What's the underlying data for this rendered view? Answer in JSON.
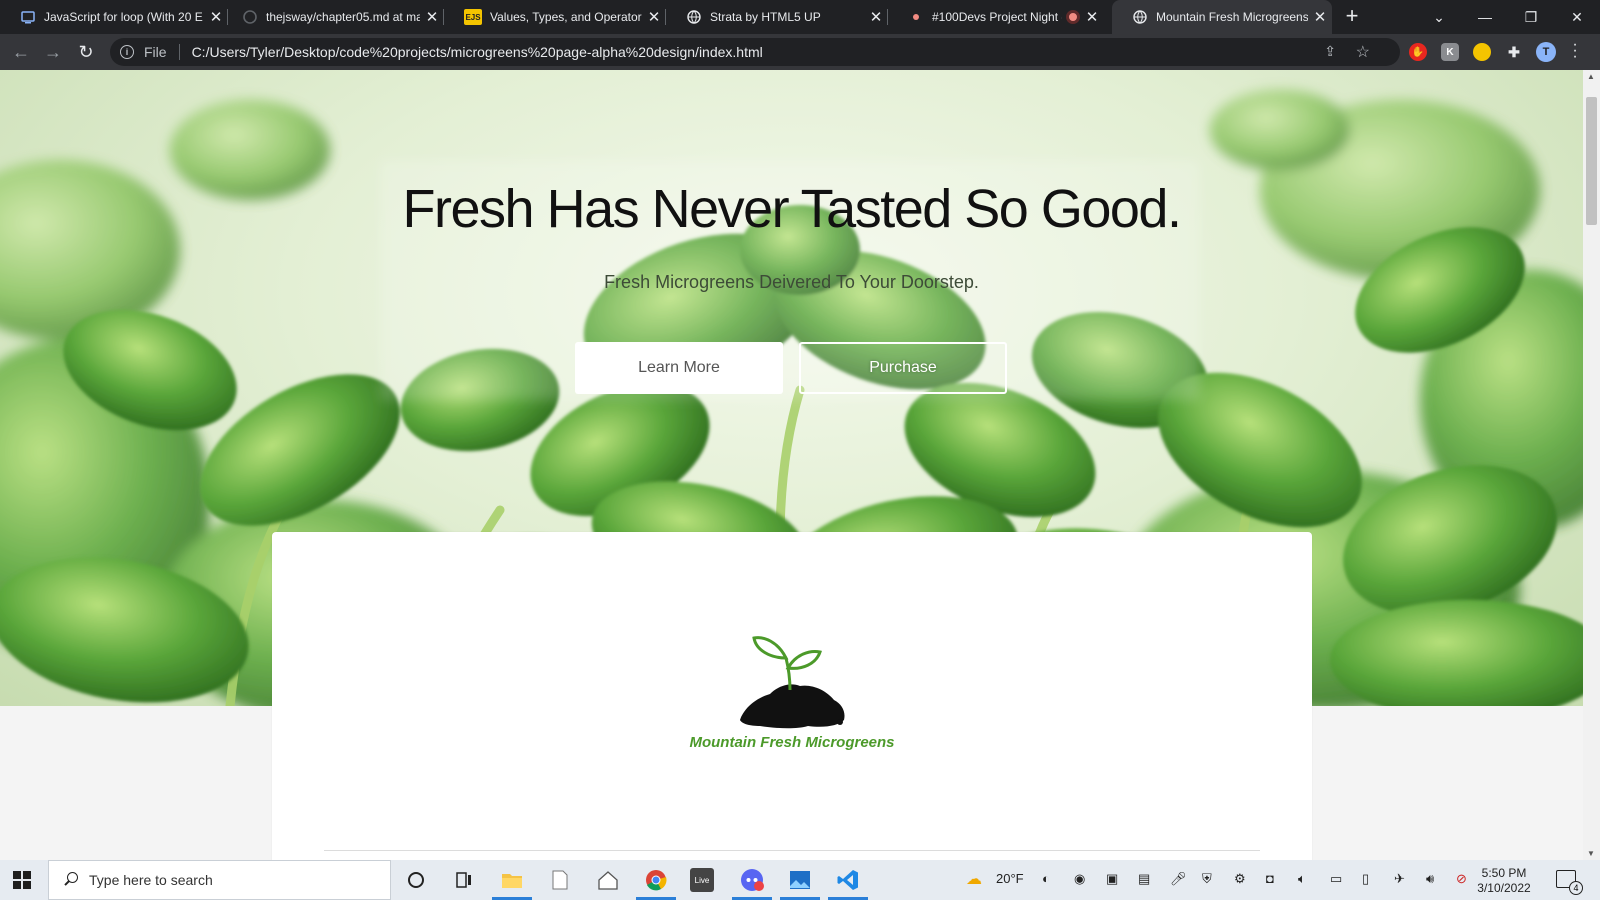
{
  "browser": {
    "tabs": [
      {
        "title": "JavaScript for loop (With 20 E",
        "icon": "programiz-icon",
        "active": false
      },
      {
        "title": "thejsway/chapter05.md at ma",
        "icon": "github-icon",
        "active": false
      },
      {
        "title": "Values, Types, and Operators",
        "icon": "ejs-icon",
        "icon_text": "EJS",
        "active": false
      },
      {
        "title": "Strata by HTML5 UP",
        "icon": "globe-icon",
        "active": false
      },
      {
        "title": "#100Devs Project Night -",
        "icon": "twitch-icon",
        "active": false
      },
      {
        "title": "Mountain Fresh Microgreens",
        "icon": "globe-icon",
        "active": true
      }
    ],
    "new_tab": "+",
    "address": {
      "scheme_label": "File",
      "url": "C:/Users/Tyler/Desktop/code%20projects/microgreens%20page-alpha%20design/index.html"
    },
    "profile_initial": "T"
  },
  "page": {
    "hero": {
      "title": "Fresh Has Never Tasted So Good.",
      "subtitle": "Fresh Microgreens Deivered To Your Doorstep.",
      "buttons": {
        "learn_more": "Learn More",
        "purchase": "Purchase"
      }
    },
    "logo": {
      "brand": "Mountain Fresh Microgreens"
    },
    "colors": {
      "brand_green": "#4c9a2a",
      "hero_leaf_green": "#5aa63a"
    }
  },
  "taskbar": {
    "search_placeholder": "Type here to search",
    "apps": [
      "cortana-icon",
      "task-view-icon",
      "file-explorer-icon",
      "notepad-icon",
      "home-icon",
      "chrome-icon",
      "live-icon",
      "discord-icon",
      "photos-icon",
      "vscode-icon"
    ],
    "live_label": "Live",
    "weather": "20°F",
    "time": "5:50 PM",
    "date": "3/10/2022",
    "notifications_count": "4"
  }
}
